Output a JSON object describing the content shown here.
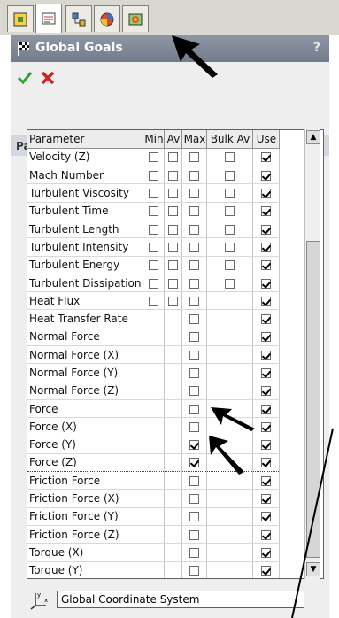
{
  "tabs": [
    {
      "icon": "feature-tree-icon"
    },
    {
      "icon": "property-manager-icon"
    },
    {
      "icon": "configuration-manager-icon"
    },
    {
      "icon": "appearance-icon"
    },
    {
      "icon": "flow-simulation-icon"
    }
  ],
  "panel": {
    "title": "Global Goals",
    "help": "?",
    "ok_icon": "check-icon",
    "cancel_icon": "close-icon"
  },
  "group": {
    "title": "Parameter",
    "collapse_icon": "double-chevron-up-icon"
  },
  "table": {
    "headers": [
      "Parameter",
      "Min",
      "Av",
      "Max",
      "Bulk Av",
      "Use"
    ],
    "rows": [
      {
        "name": "Velocity (Z)",
        "cols": [
          0,
          0,
          0,
          0,
          1
        ],
        "full": true
      },
      {
        "name": "Mach Number",
        "cols": [
          0,
          0,
          0,
          0,
          1
        ],
        "full": true
      },
      {
        "name": "Turbulent Viscosity",
        "cols": [
          0,
          0,
          0,
          0,
          1
        ],
        "full": true
      },
      {
        "name": "Turbulent Time",
        "cols": [
          0,
          0,
          0,
          0,
          1
        ],
        "full": true
      },
      {
        "name": "Turbulent Length",
        "cols": [
          0,
          0,
          0,
          0,
          1
        ],
        "full": true
      },
      {
        "name": "Turbulent Intensity",
        "cols": [
          0,
          0,
          0,
          0,
          1
        ],
        "full": true
      },
      {
        "name": "Turbulent Energy",
        "cols": [
          0,
          0,
          0,
          0,
          1
        ],
        "full": true
      },
      {
        "name": "Turbulent Dissipation",
        "cols": [
          0,
          0,
          0,
          0,
          1
        ],
        "full": true
      },
      {
        "name": "Heat Flux",
        "cols": [
          0,
          0,
          0,
          null,
          1
        ],
        "full": true
      },
      {
        "name": "Heat Transfer Rate",
        "cols": [
          null,
          null,
          0,
          null,
          1
        ],
        "full": false
      },
      {
        "name": "Normal Force",
        "cols": [
          null,
          null,
          0,
          null,
          1
        ],
        "full": false
      },
      {
        "name": "Normal Force (X)",
        "cols": [
          null,
          null,
          0,
          null,
          1
        ],
        "full": false
      },
      {
        "name": "Normal Force (Y)",
        "cols": [
          null,
          null,
          0,
          null,
          1
        ],
        "full": false
      },
      {
        "name": "Normal Force (Z)",
        "cols": [
          null,
          null,
          0,
          null,
          1
        ],
        "full": false
      },
      {
        "name": "Force",
        "cols": [
          null,
          null,
          0,
          null,
          1
        ],
        "full": false
      },
      {
        "name": "Force (X)",
        "cols": [
          null,
          null,
          0,
          null,
          1
        ],
        "full": false
      },
      {
        "name": "Force (Y)",
        "cols": [
          null,
          null,
          1,
          null,
          1
        ],
        "full": false
      },
      {
        "name": "Force (Z)",
        "cols": [
          null,
          null,
          1,
          null,
          1
        ],
        "full": false,
        "focus": true
      },
      {
        "name": "Friction Force",
        "cols": [
          null,
          null,
          0,
          null,
          1
        ],
        "full": false
      },
      {
        "name": "Friction Force (X)",
        "cols": [
          null,
          null,
          0,
          null,
          1
        ],
        "full": false
      },
      {
        "name": "Friction Force (Y)",
        "cols": [
          null,
          null,
          0,
          null,
          1
        ],
        "full": false
      },
      {
        "name": "Friction Force (Z)",
        "cols": [
          null,
          null,
          0,
          null,
          1
        ],
        "full": false
      },
      {
        "name": "Torque (X)",
        "cols": [
          null,
          null,
          0,
          null,
          1
        ],
        "full": false
      },
      {
        "name": "Torque (Y)",
        "cols": [
          null,
          null,
          0,
          null,
          1
        ],
        "full": false
      }
    ]
  },
  "coordinate_system": {
    "icon": "coordinate-axes-icon",
    "value": "Global Coordinate System"
  }
}
